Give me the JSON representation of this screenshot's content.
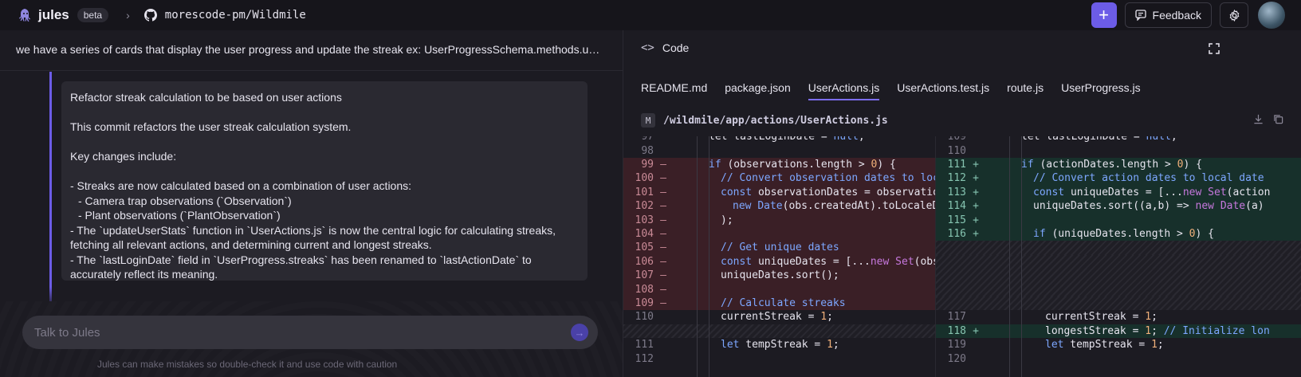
{
  "header": {
    "brand": "jules",
    "badge": "beta",
    "repo": "morescode-pm/Wildmile",
    "feedback_label": "Feedback"
  },
  "left": {
    "prompt": "we have a series of cards that display the user progress and update the streak ex: UserProgressSchema.methods.upd…",
    "commit_lines": [
      "Refactor streak calculation to be based on user actions",
      "",
      "This commit refactors the user streak calculation system.",
      "",
      "Key changes include:",
      "",
      "- Streaks are now calculated based on a combination of user actions:",
      "    - Camera trap observations (`Observation`)",
      "    - Plant observations (`PlantObservation`)",
      "- The `updateUserStats` function in `UserActions.js` is now the central logic for calculating streaks,",
      "fetching all relevant actions, and determining current and longest streaks.",
      "- The `lastLoginDate` field in `UserProgress.streaks` has been renamed to `lastActionDate` to",
      "accurately reflect its meaning."
    ],
    "chat_placeholder": "Talk to Jules",
    "hint": "Jules can make mistakes so double-check it and use code with caution"
  },
  "code": {
    "title": "Code",
    "tabs": [
      "README.md",
      "package.json",
      "UserActions.js",
      "UserActions.test.js",
      "route.js",
      "UserProgress.js"
    ],
    "active_tab": 2,
    "file_status": "M",
    "file_path": "/wildmile/app/actions/UserActions.js"
  },
  "diff": {
    "left": [
      {
        "ln": "97",
        "mk": "",
        "type": "ctx",
        "indent": 1,
        "html": "let lastLoginDate = <span class='k'>null</span>;"
      },
      {
        "ln": "98",
        "mk": "",
        "type": "ctx",
        "indent": 0,
        "html": ""
      },
      {
        "ln": "99",
        "mk": "—",
        "type": "del",
        "indent": 1,
        "html": "<span class='k'>if</span> (observations.length &gt; <span class='n'>0</span>) {"
      },
      {
        "ln": "100",
        "mk": "—",
        "type": "del",
        "indent": 2,
        "html": "<span class='c'>// Convert observation dates to local</span>"
      },
      {
        "ln": "101",
        "mk": "—",
        "type": "del",
        "indent": 2,
        "html": "<span class='k'>const</span> observationDates = observations."
      },
      {
        "ln": "102",
        "mk": "—",
        "type": "del",
        "indent": 3,
        "html": "<span class='k'>new</span> <span class='k'>Date</span>(obs.createdAt).toLocaleDate"
      },
      {
        "ln": "103",
        "mk": "—",
        "type": "del",
        "indent": 2,
        "html": ");"
      },
      {
        "ln": "104",
        "mk": "—",
        "type": "del",
        "indent": 0,
        "html": ""
      },
      {
        "ln": "105",
        "mk": "—",
        "type": "del",
        "indent": 2,
        "html": "<span class='c'>// Get unique dates</span>"
      },
      {
        "ln": "106",
        "mk": "—",
        "type": "del",
        "indent": 2,
        "html": "<span class='k'>const</span> uniqueDates = [...<span class='p'>new</span> <span class='p'>Set</span>(observ"
      },
      {
        "ln": "107",
        "mk": "—",
        "type": "del",
        "indent": 2,
        "html": "uniqueDates.sort();"
      },
      {
        "ln": "108",
        "mk": "—",
        "type": "del",
        "indent": 0,
        "html": ""
      },
      {
        "ln": "109",
        "mk": "—",
        "type": "del",
        "indent": 2,
        "html": "<span class='c'>// Calculate streaks</span>"
      },
      {
        "ln": "110",
        "mk": "",
        "type": "ctx",
        "indent": 2,
        "html": "currentStreak = <span class='n'>1</span>;"
      },
      {
        "ln": "",
        "mk": "",
        "type": "hatch",
        "indent": 0,
        "html": ""
      },
      {
        "ln": "111",
        "mk": "",
        "type": "ctx",
        "indent": 2,
        "html": "<span class='k'>let</span> tempStreak = <span class='n'>1</span>;"
      },
      {
        "ln": "112",
        "mk": "",
        "type": "ctx",
        "indent": 0,
        "html": ""
      }
    ],
    "right": [
      {
        "ln": "109",
        "mk": "",
        "type": "ctx",
        "indent": 1,
        "html": "let lastLoginDate = <span class='k'>null</span>;"
      },
      {
        "ln": "110",
        "mk": "",
        "type": "ctx",
        "indent": 0,
        "html": ""
      },
      {
        "ln": "111",
        "mk": "+",
        "type": "add",
        "indent": 1,
        "html": "<span class='k'>if</span> (actionDates.length &gt; <span class='n'>0</span>) {"
      },
      {
        "ln": "112",
        "mk": "+",
        "type": "add",
        "indent": 2,
        "html": "<span class='c'>// Convert action dates to local date</span>"
      },
      {
        "ln": "113",
        "mk": "+",
        "type": "add",
        "indent": 2,
        "html": "<span class='k'>const</span> uniqueDates = [...<span class='p'>new</span> <span class='p'>Set</span>(action"
      },
      {
        "ln": "114",
        "mk": "+",
        "type": "add",
        "indent": 2,
        "html": "uniqueDates.sort((a,b) =&gt; <span class='p'>new</span> <span class='p'>Date</span>(a)"
      },
      {
        "ln": "115",
        "mk": "+",
        "type": "add",
        "indent": 0,
        "html": ""
      },
      {
        "ln": "116",
        "mk": "+",
        "type": "add",
        "indent": 2,
        "html": "<span class='k'>if</span> (uniqueDates.length &gt; <span class='n'>0</span>) {"
      },
      {
        "ln": "",
        "mk": "",
        "type": "hatch",
        "indent": 0,
        "html": ""
      },
      {
        "ln": "",
        "mk": "",
        "type": "hatch",
        "indent": 0,
        "html": ""
      },
      {
        "ln": "",
        "mk": "",
        "type": "hatch",
        "indent": 0,
        "html": ""
      },
      {
        "ln": "",
        "mk": "",
        "type": "hatch",
        "indent": 0,
        "html": ""
      },
      {
        "ln": "",
        "mk": "",
        "type": "hatch",
        "indent": 0,
        "html": ""
      },
      {
        "ln": "117",
        "mk": "",
        "type": "ctx",
        "indent": 3,
        "html": "currentStreak = <span class='n'>1</span>;"
      },
      {
        "ln": "118",
        "mk": "+",
        "type": "add",
        "indent": 3,
        "html": "longestStreak = <span class='n'>1</span>; <span class='c'>// Initialize lon</span>"
      },
      {
        "ln": "119",
        "mk": "",
        "type": "ctx",
        "indent": 3,
        "html": "<span class='k'>let</span> tempStreak = <span class='n'>1</span>;"
      },
      {
        "ln": "120",
        "mk": "",
        "type": "ctx",
        "indent": 0,
        "html": ""
      }
    ]
  }
}
